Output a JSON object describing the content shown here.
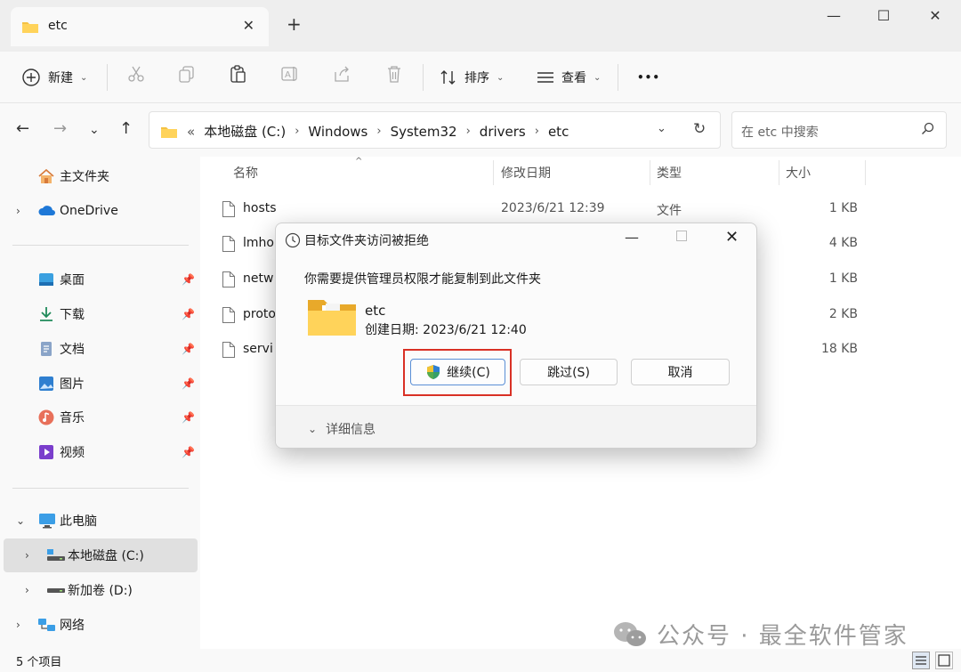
{
  "window": {
    "tab_title": "etc",
    "tab_close": "✕",
    "new_tab": "+",
    "minimize": "—",
    "maximize": "☐",
    "close": "✕"
  },
  "toolbar": {
    "new_label": "新建",
    "sort_label": "排序",
    "view_label": "查看",
    "more_label": "•••"
  },
  "address": {
    "prefix": "«",
    "crumbs": [
      "本地磁盘 (C:)",
      "Windows",
      "System32",
      "drivers",
      "etc"
    ],
    "search_placeholder": "在 etc 中搜索"
  },
  "sidebar": {
    "home": "主文件夹",
    "onedrive": "OneDrive",
    "quick": [
      {
        "label": "桌面",
        "icon": "desktop-icon"
      },
      {
        "label": "下载",
        "icon": "download-icon"
      },
      {
        "label": "文档",
        "icon": "documents-icon"
      },
      {
        "label": "图片",
        "icon": "pictures-icon"
      },
      {
        "label": "音乐",
        "icon": "music-icon"
      },
      {
        "label": "视频",
        "icon": "videos-icon"
      }
    ],
    "this_pc": "此电脑",
    "drive_c": "本地磁盘 (C:)",
    "drive_d": "新加卷 (D:)",
    "network": "网络"
  },
  "columns": {
    "name": "名称",
    "modified": "修改日期",
    "type": "类型",
    "size": "大小"
  },
  "files": [
    {
      "name": "hosts",
      "modified": "2023/6/21 12:39",
      "type": "文件",
      "size": "1 KB"
    },
    {
      "name": "lmho",
      "modified": "",
      "type": "",
      "size": "4 KB"
    },
    {
      "name": "netw",
      "modified": "",
      "type": "",
      "size": "1 KB"
    },
    {
      "name": "proto",
      "modified": "",
      "type": "",
      "size": "2 KB"
    },
    {
      "name": "servi",
      "modified": "",
      "type": "",
      "size": "18 KB"
    }
  ],
  "status": {
    "count": "5 个项目"
  },
  "dialog": {
    "title": "目标文件夹访问被拒绝",
    "message": "你需要提供管理员权限才能复制到此文件夹",
    "folder_name": "etc",
    "created": "创建日期: 2023/6/21 12:40",
    "continue_label": "继续(C)",
    "skip_label": "跳过(S)",
    "cancel_label": "取消",
    "details_label": "详细信息",
    "highlight_color": "#d93025"
  },
  "watermark": {
    "text": "公众号 · 最全软件管家"
  }
}
